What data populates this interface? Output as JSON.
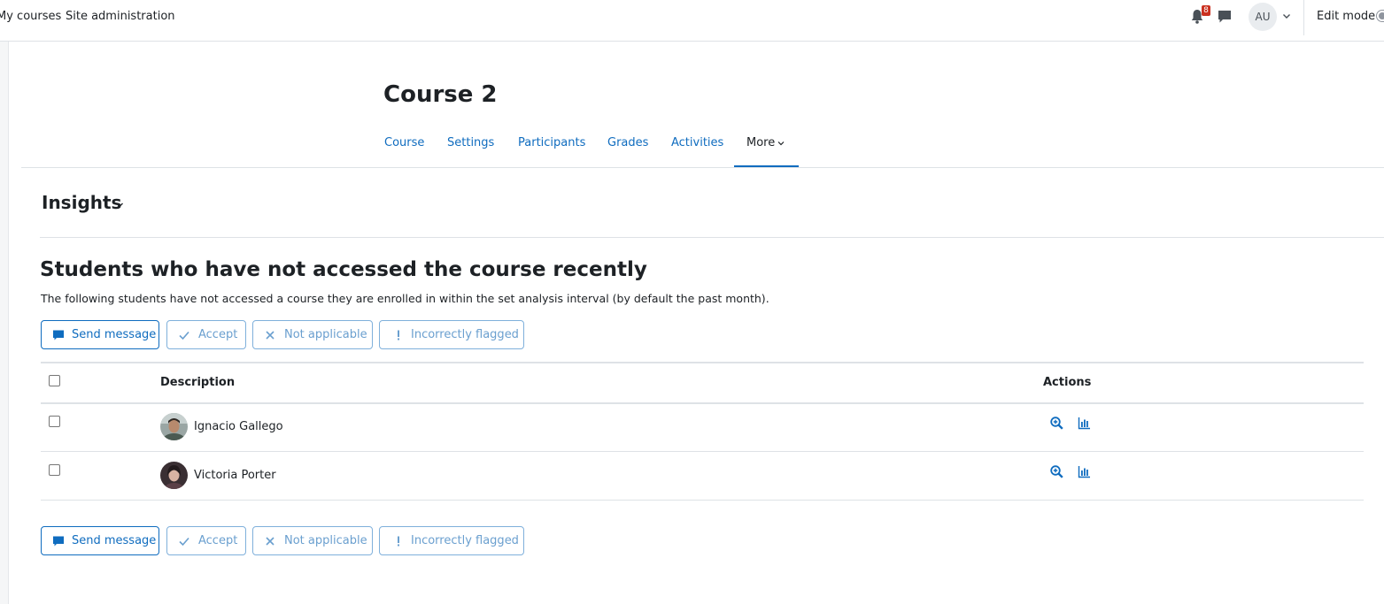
{
  "navbar": {
    "links": [
      "My courses",
      "Site administration"
    ],
    "notifications_count": "8",
    "user_initials": "AU",
    "edit_mode_label": "Edit mode"
  },
  "course": {
    "title": "Course 2",
    "tabs": [
      "Course",
      "Settings",
      "Participants",
      "Grades",
      "Activities",
      "More"
    ],
    "active_tab": "More"
  },
  "insights": {
    "selector_label": "Insights",
    "heading": "Students who have not accessed the course recently",
    "description": "The following students have not accessed a course they are enrolled in within the set analysis interval (by default the past month).",
    "actions": [
      "Send message",
      "Accept",
      "Not applicable",
      "Incorrectly flagged"
    ]
  },
  "table": {
    "headers": {
      "description": "Description",
      "actions": "Actions"
    },
    "rows": [
      {
        "name": "Ignacio Gallego"
      },
      {
        "name": "Victoria Porter"
      }
    ]
  },
  "colors": {
    "primary": "#0f6cbf",
    "text": "#1d2125",
    "border": "#dee2e6",
    "badge": "#ca3120"
  },
  "icons": [
    "bell-icon",
    "chat-icon",
    "chevron-down-icon",
    "message-icon",
    "check-icon",
    "close-icon",
    "exclamation-icon",
    "magnifier-plus-icon",
    "bar-chart-icon"
  ]
}
